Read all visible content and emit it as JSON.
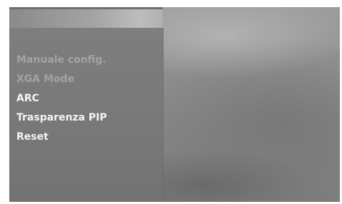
{
  "menu": {
    "items": [
      {
        "label": "Manuale config.",
        "state": "disabled"
      },
      {
        "label": "XGA Mode",
        "state": "disabled"
      },
      {
        "label": "ARC",
        "state": "enabled"
      },
      {
        "label": "Trasparenza PIP",
        "state": "enabled"
      },
      {
        "label": "Reset",
        "state": "enabled"
      }
    ]
  },
  "colors": {
    "disabled_text": "#a3a3a3",
    "enabled_text": "#f4f4f4"
  }
}
